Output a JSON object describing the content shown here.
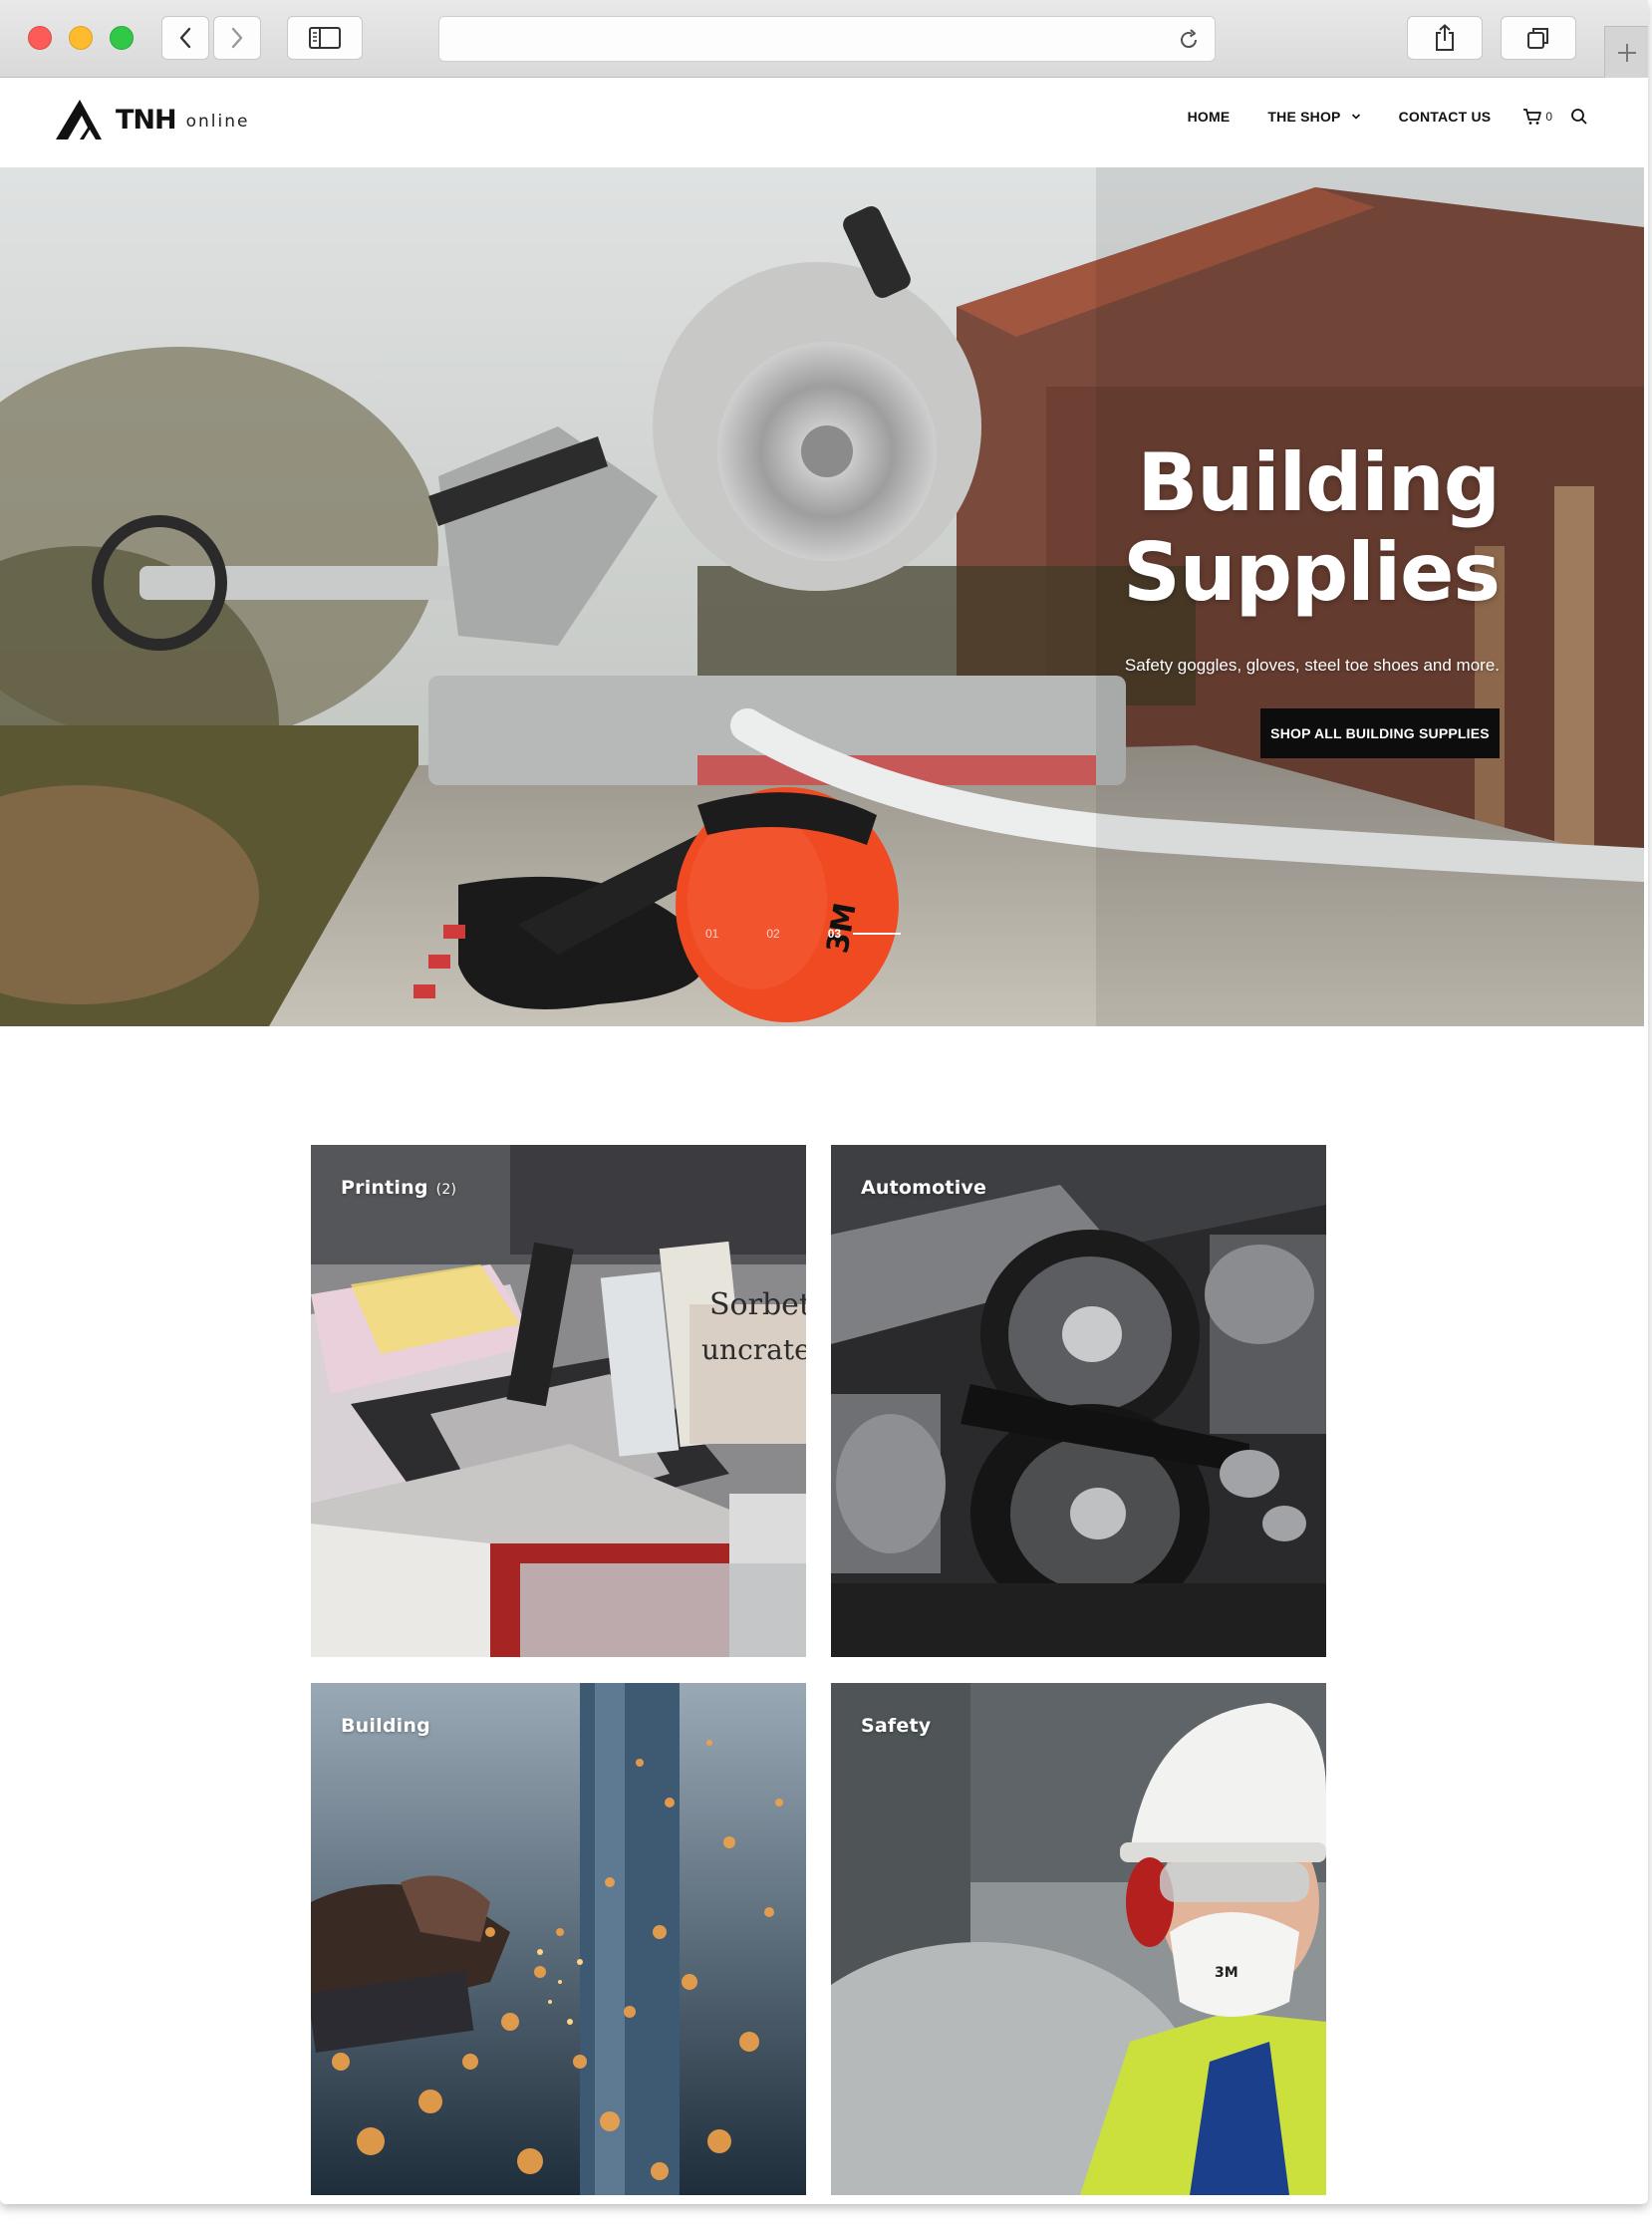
{
  "brand": {
    "name": "TNH",
    "suffix": "online"
  },
  "nav": {
    "items": [
      {
        "label": "HOME"
      },
      {
        "label": "THE SHOP"
      },
      {
        "label": "CONTACT US"
      }
    ],
    "cart_count": "0"
  },
  "hero": {
    "title_line1": "Building",
    "title_line2": "Supplies",
    "subtitle": "Safety goggles, gloves, steel toe shoes and more.",
    "cta_label": "SHOP ALL BUILDING SUPPLIES",
    "slides": [
      "01",
      "02",
      "03"
    ],
    "active_slide": "03"
  },
  "categories": [
    {
      "name": "Printing",
      "count": "(2)"
    },
    {
      "name": "Automotive"
    },
    {
      "name": "Building"
    },
    {
      "name": "Safety"
    }
  ],
  "colors": {
    "accent_dark": "#0d0d0d",
    "earmuff_orange": "#f04a23",
    "traffic_red": "#fc5b57",
    "traffic_yellow": "#fdbc2e",
    "traffic_green": "#33c748"
  }
}
